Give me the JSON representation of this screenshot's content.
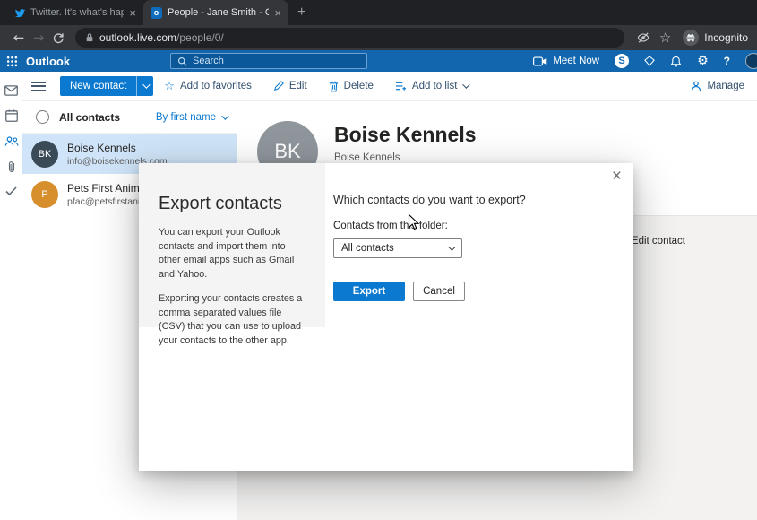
{
  "browser": {
    "tabs": [
      {
        "title": "Twitter. It's what's happen"
      },
      {
        "title": "People - Jane Smith - Outlo"
      }
    ],
    "url": {
      "host": "outlook.live.com",
      "path": "/people/0/"
    },
    "incognito_label": "Incognito"
  },
  "icons": {
    "back": "←",
    "forward": "→",
    "star": "☆",
    "gear": "⚙",
    "help": "?",
    "close_tab": "×",
    "close_dialog": "×",
    "new_tab": "+",
    "outlook_favicon": "o",
    "skype_initial": "S"
  },
  "outlook_header": {
    "app_name": "Outlook",
    "search_placeholder": "Search",
    "meet_now": "Meet Now"
  },
  "command_bar": {
    "new_contact": "New contact",
    "add_to_favorites": "Add to favorites",
    "edit": "Edit",
    "delete": "Delete",
    "add_to_list": "Add to list",
    "manage": "Manage"
  },
  "contact_list": {
    "title": "All contacts",
    "sort": "By first name",
    "contacts": [
      {
        "initials": "BK",
        "name": "Boise Kennels",
        "email": "info@boisekennels.com",
        "color": "#3a4a57"
      },
      {
        "initials": "P",
        "name": "Pets First Animal Clinic",
        "email": "pfac@petsfirstanimalclinic",
        "color": "#d78f2e"
      }
    ]
  },
  "detail": {
    "initials": "BK",
    "name": "Boise Kennels",
    "subtitle": "Boise Kennels",
    "edit_contact": "Edit contact",
    "avatar_color": "#8f969c"
  },
  "dialog": {
    "title": "Export contacts",
    "paragraph1": "You can export your Outlook contacts and import them into other email apps such as Gmail and Yahoo.",
    "paragraph2": "Exporting your contacts creates a comma separated values file (CSV) that you can use to upload your contacts to the other app.",
    "question": "Which contacts do you want to export?",
    "folder_label": "Contacts from this folder:",
    "folder_value": "All contacts",
    "export": "Export",
    "cancel": "Cancel"
  },
  "colors": {
    "accent": "#0b79d0",
    "header_blue": "#1166ad",
    "selected_row": "#cfe4f8"
  }
}
